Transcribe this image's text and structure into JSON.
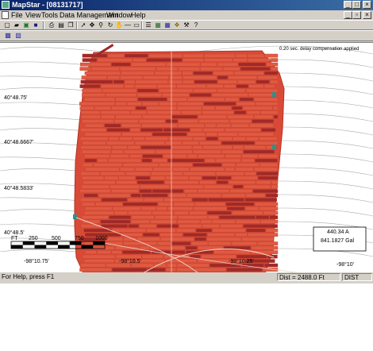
{
  "window": {
    "title": "MapStar - [08131717]"
  },
  "menu": {
    "items": [
      "File",
      "View",
      "Tools",
      "Data Management",
      "Window",
      "Help"
    ]
  },
  "map": {
    "annotation": "0.20 sec. delay compensation applied",
    "lat_labels": [
      "40°48.75'",
      "40°48.6667'",
      "40°48.5833'",
      "40°48.5'"
    ],
    "lon_labels": [
      "-98°10.75'",
      "-98°10.5'",
      "-98°10.25'",
      "-98°10'"
    ],
    "scale": {
      "unit": "FT",
      "ticks": [
        "250",
        "500",
        "750",
        "1000"
      ]
    },
    "readout": {
      "line1": "440.34 A",
      "line2": "841.1827 Gal"
    },
    "colors": {
      "field_fill": "#d94a36",
      "field_strip": "#9e2a28",
      "field_edge": "#b03428",
      "contour": "#aaaaaa",
      "accent": "#2f8f8a"
    }
  },
  "status": {
    "help": "For Help, press F1",
    "distance": "Dist = 2488.0 Ft",
    "mode": "DIST"
  }
}
